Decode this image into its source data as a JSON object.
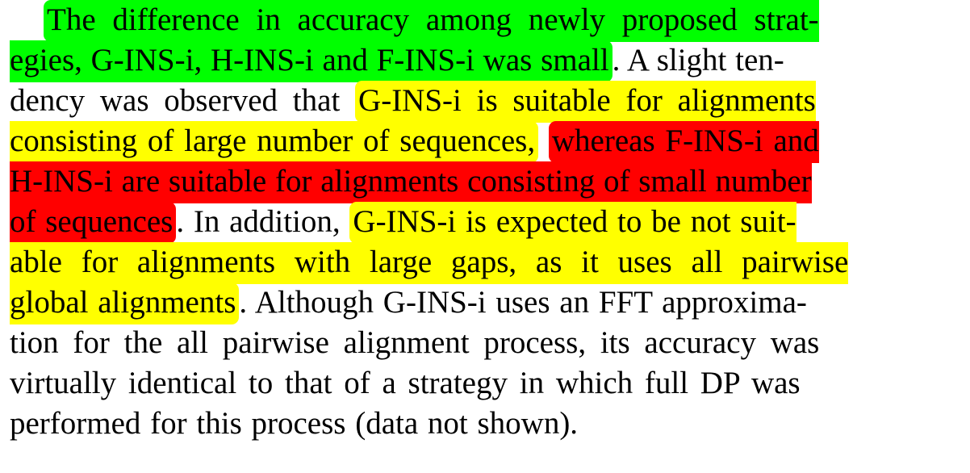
{
  "document": {
    "type": "highlighted-paragraph",
    "background_color": "#ffffff",
    "text_color": "#000000",
    "highlight_colors": {
      "green": "#00ff00",
      "yellow": "#ffff00",
      "red": "#ff0000"
    },
    "full_text": "The difference in accuracy among newly proposed strategies, G-INS-i, H-INS-i and F-INS-i was small. A slight tendency was observed that G-INS-i is suitable for alignments consisting of large number of sequences, whereas F-INS-i and H-INS-i are suitable for alignments consisting of small number of sequences. In addition, G-INS-i is expected to be not suitable for alignments with large gaps, as it uses all pairwise global alignments. Although G-INS-i uses an FFT approximation for the all pairwise alignment process, its accuracy was virtually identical to that of a strategy in which full DP was performed for this process (data not shown).",
    "highlighted_passages": [
      {
        "color": "green",
        "text": "The difference in accuracy among newly proposed strategies, G-INS-i, H-INS-i and F-INS-i was small"
      },
      {
        "color": "yellow",
        "text": "G-INS-i is suitable for alignments consisting of large number of sequences,"
      },
      {
        "color": "red",
        "text": "whereas F-INS-i and H-INS-i are suitable for alignments consisting of small number of sequences"
      },
      {
        "color": "yellow",
        "text": "G-INS-i is expected to be not suitable for alignments with large gaps, as it uses all pairwise global alignments"
      }
    ],
    "lines": [
      {
        "index": 1,
        "indent": true,
        "segments": [
          {
            "text": "The difference in accuracy among newly proposed strat-",
            "highlight": "green",
            "open_right": true
          }
        ]
      },
      {
        "index": 2,
        "indent": false,
        "segments": [
          {
            "text": "egies, G-INS-i, H-INS-i and F-INS-i was small",
            "highlight": "green",
            "open_left": true
          },
          {
            "text": ". A slight ten-",
            "highlight": "none"
          }
        ]
      },
      {
        "index": 3,
        "indent": false,
        "segments": [
          {
            "text": "dency was observed that ",
            "highlight": "none"
          },
          {
            "text": "G-INS-i is suitable for alignments",
            "highlight": "yellow",
            "open_right": true
          }
        ]
      },
      {
        "index": 4,
        "indent": false,
        "segments": [
          {
            "text": "consisting of large number of sequences,",
            "highlight": "yellow",
            "open_left": true
          },
          {
            "text": " ",
            "highlight": "none"
          },
          {
            "text": "whereas F-INS-i and",
            "highlight": "red",
            "open_right": true
          }
        ]
      },
      {
        "index": 5,
        "indent": false,
        "segments": [
          {
            "text": "H-INS-i are suitable for alignments consisting of small number",
            "highlight": "red",
            "open_left": true,
            "open_right": true
          }
        ]
      },
      {
        "index": 6,
        "indent": false,
        "segments": [
          {
            "text": "of sequences",
            "highlight": "red",
            "open_left": true
          },
          {
            "text": ". In addition, ",
            "highlight": "none"
          },
          {
            "text": "G-INS-i is expected to be not suit-",
            "highlight": "yellow",
            "open_right": true
          }
        ]
      },
      {
        "index": 7,
        "indent": false,
        "segments": [
          {
            "text": "able for alignments with large gaps, as it uses all pairwise",
            "highlight": "yellow",
            "open_left": true,
            "open_right": true
          }
        ]
      },
      {
        "index": 8,
        "indent": false,
        "segments": [
          {
            "text": "global alignments",
            "highlight": "yellow",
            "open_left": true
          },
          {
            "text": ". Although G-INS-i uses an FFT approxima-",
            "highlight": "none"
          }
        ]
      },
      {
        "index": 9,
        "indent": false,
        "segments": [
          {
            "text": "tion for the all pairwise alignment process, its accuracy was",
            "highlight": "none"
          }
        ]
      },
      {
        "index": 10,
        "indent": false,
        "segments": [
          {
            "text": "virtually identical to that of a strategy in which full DP was",
            "highlight": "none"
          }
        ]
      },
      {
        "index": 11,
        "indent": false,
        "segments": [
          {
            "text": "performed for this process (data not shown).",
            "highlight": "none"
          }
        ]
      }
    ]
  }
}
